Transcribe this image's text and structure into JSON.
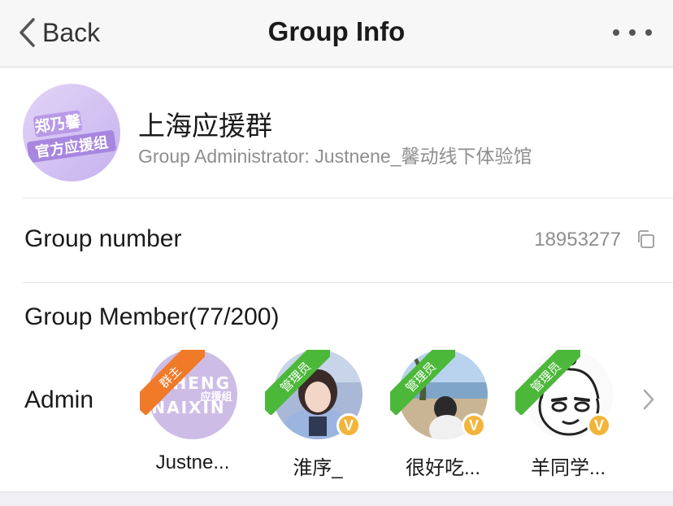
{
  "nav": {
    "back_label": "Back",
    "title": "Group Info"
  },
  "group": {
    "name": "上海应援群",
    "admin_text": "Group Administrator: Justnene_馨动线下体验馆",
    "avatar_text_line1": "郑乃馨",
    "avatar_text_line2": "官方应援组"
  },
  "group_number": {
    "label": "Group number",
    "value": "18953277"
  },
  "members": {
    "title": "Group Member(77/200)",
    "admin_label": "Admin",
    "list": [
      {
        "name": "Justne...",
        "badge": "群主",
        "badge_color": "#f07a28",
        "verified": false,
        "avatar_text_1": "ZHENG",
        "avatar_text_2": "NAIXIN",
        "avatar_text_3": "应援组"
      },
      {
        "name": "淮序_",
        "badge": "管理员",
        "badge_color": "#4cb83a",
        "verified": true,
        "verified_mark": "V"
      },
      {
        "name": "很好吃...",
        "badge": "管理员",
        "badge_color": "#4cb83a",
        "verified": true,
        "verified_mark": "V"
      },
      {
        "name": "羊同学...",
        "badge": "管理员",
        "badge_color": "#4cb83a",
        "verified": true,
        "verified_mark": "V"
      }
    ]
  },
  "colors": {
    "navbar_bg": "#f7f7f7",
    "secondary_text": "#8e8e8e",
    "owner_badge": "#f07a28",
    "admin_badge": "#4cb83a",
    "verified": "#f3b43a"
  }
}
